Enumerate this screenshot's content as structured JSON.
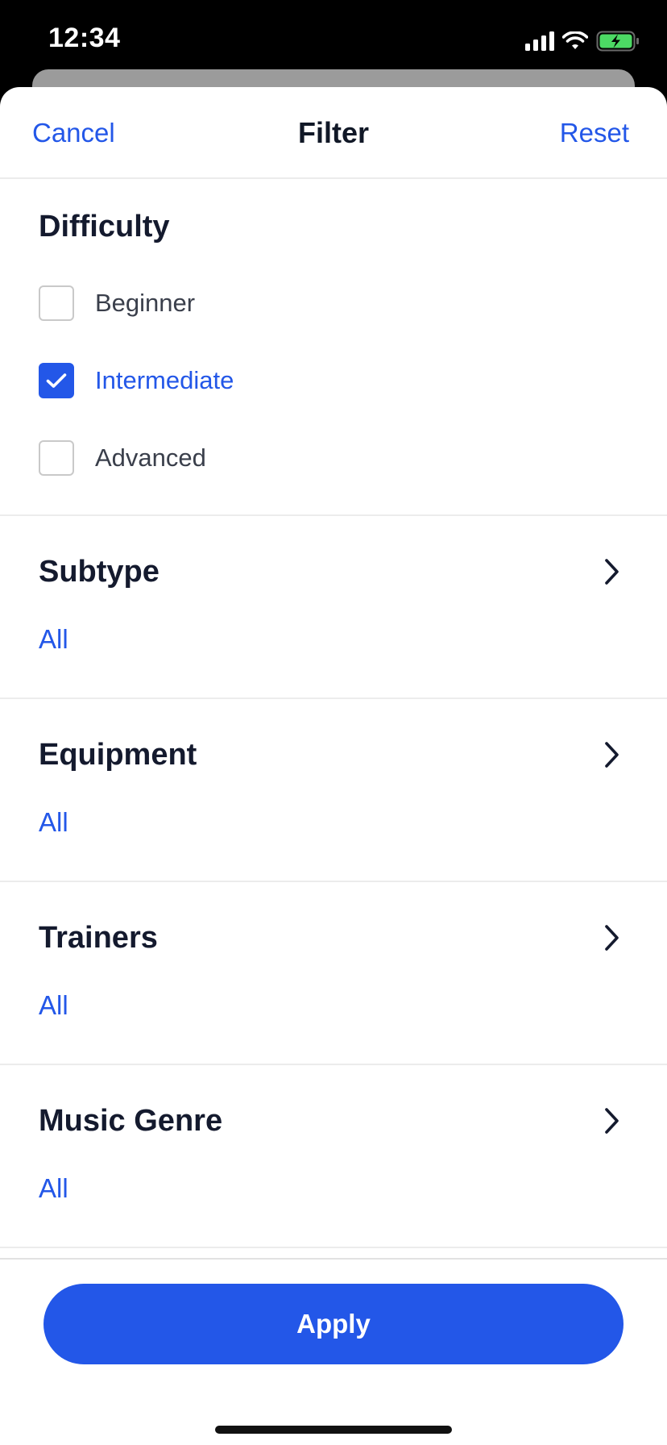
{
  "status_bar": {
    "time": "12:34"
  },
  "nav": {
    "cancel_label": "Cancel",
    "title": "Filter",
    "reset_label": "Reset"
  },
  "difficulty": {
    "heading": "Difficulty",
    "options": [
      {
        "label": "Beginner",
        "checked": false
      },
      {
        "label": "Intermediate",
        "checked": true
      },
      {
        "label": "Advanced",
        "checked": false
      }
    ]
  },
  "sections": [
    {
      "heading": "Subtype",
      "value": "All"
    },
    {
      "heading": "Equipment",
      "value": "All"
    },
    {
      "heading": "Trainers",
      "value": "All"
    },
    {
      "heading": "Music Genre",
      "value": "All"
    }
  ],
  "footer": {
    "apply_label": "Apply"
  },
  "colors": {
    "accent": "#2357e8",
    "battery": "#4cd964"
  },
  "icons": [
    "signal-icon",
    "wifi-icon",
    "battery-icon",
    "checkmark-icon",
    "chevron-right-icon"
  ]
}
